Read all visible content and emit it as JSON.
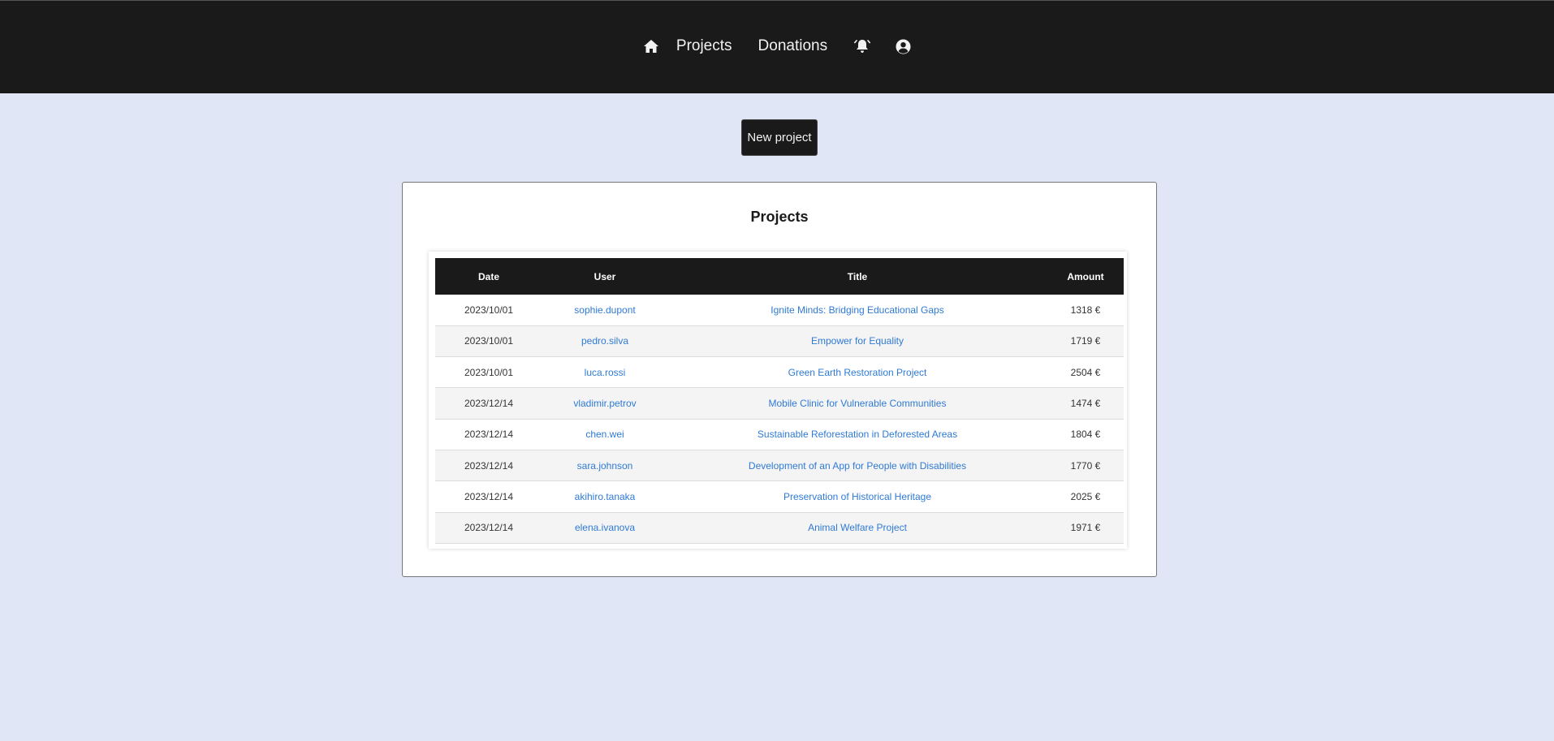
{
  "nav": {
    "home_icon": "home-icon",
    "projects": "Projects",
    "donations": "Donations",
    "bell_icon": "bell-icon",
    "account_icon": "user-circle-icon"
  },
  "actions": {
    "new_project": "New project"
  },
  "panel": {
    "title": "Projects",
    "columns": [
      "Date",
      "User",
      "Title",
      "Amount"
    ],
    "rows": [
      {
        "date": "2023/10/01",
        "user": "sophie.dupont",
        "title": "Ignite Minds: Bridging Educational Gaps",
        "amount": "1318 €"
      },
      {
        "date": "2023/10/01",
        "user": "pedro.silva",
        "title": "Empower for Equality",
        "amount": "1719 €"
      },
      {
        "date": "2023/10/01",
        "user": "luca.rossi",
        "title": "Green Earth Restoration Project",
        "amount": "2504 €"
      },
      {
        "date": "2023/12/14",
        "user": "vladimir.petrov",
        "title": "Mobile Clinic for Vulnerable Communities",
        "amount": "1474 €"
      },
      {
        "date": "2023/12/14",
        "user": "chen.wei",
        "title": "Sustainable Reforestation in Deforested Areas",
        "amount": "1804 €"
      },
      {
        "date": "2023/12/14",
        "user": "sara.johnson",
        "title": "Development of an App for People with Disabilities",
        "amount": "1770 €"
      },
      {
        "date": "2023/12/14",
        "user": "akihiro.tanaka",
        "title": "Preservation of Historical Heritage",
        "amount": "2025 €"
      },
      {
        "date": "2023/12/14",
        "user": "elena.ivanova",
        "title": "Animal Welfare Project",
        "amount": "1971 €"
      }
    ]
  },
  "colors": {
    "topbar": "#1a1a1a",
    "background": "#e0e6f5",
    "link": "#2f7ad6",
    "card": "#ffffff"
  }
}
